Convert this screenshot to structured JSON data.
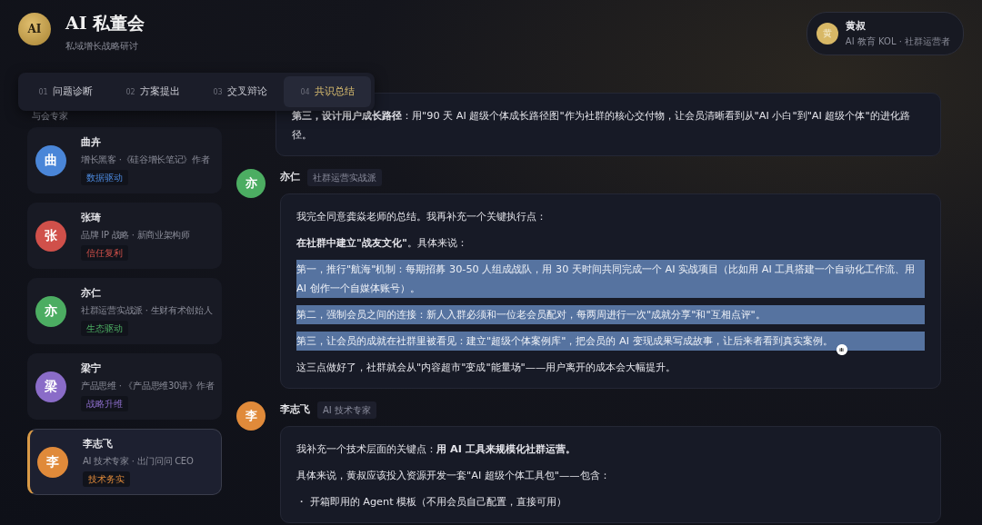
{
  "app": {
    "logo": "AI",
    "title": "AI 私董会",
    "subtitle": "私域增长战略研讨"
  },
  "user": {
    "avatar": "黄",
    "name": "黄叔",
    "role": "AI 教育 KOL · 社群运营者"
  },
  "tabs": [
    {
      "number": "01",
      "label": "问题诊断",
      "selected": false
    },
    {
      "number": "02",
      "label": "方案提出",
      "selected": false
    },
    {
      "number": "03",
      "label": "交叉辩论",
      "selected": false
    },
    {
      "number": "04",
      "label": "共识总结",
      "selected": true
    }
  ],
  "sidebar": {
    "heading": "与会专家",
    "experts": [
      {
        "avatar": "曲",
        "name": "曲卉",
        "title": "增长黑客 ·《硅谷增长笔记》作者",
        "tag": "数据驱动",
        "color": "#4a86d8",
        "selected": false
      },
      {
        "avatar": "张",
        "name": "张琦",
        "title": "品牌 IP 战略 · 新商业架构师",
        "tag": "信任复利",
        "color": "#d0504a",
        "selected": false
      },
      {
        "avatar": "亦",
        "name": "亦仁",
        "title": "社群运营实战派 · 生财有术创始人",
        "tag": "生态驱动",
        "color": "#4cad62",
        "selected": false
      },
      {
        "avatar": "梁",
        "name": "梁宁",
        "title": "产品思维 · 《产品思维30讲》作者",
        "tag": "战略升维",
        "color": "#8a6cc8",
        "selected": false
      },
      {
        "avatar": "李",
        "name": "李志飞",
        "title": "AI 技术专家 · 出门问问 CEO",
        "tag": "技术务实",
        "color": "#e08a3a",
        "selected": true
      }
    ]
  },
  "messages": [
    {
      "paragraphs": [
        {
          "text": "**第三，设计用户成长路径**：用\"90 天 AI 超级个体成长路径图\"作为社群的核心交付物，让会员清晰看到从\"AI 小白\"到\"AI 超级个体\"的进化路径。",
          "highlighted": false
        }
      ]
    },
    {
      "avatar": "亦",
      "name": "亦仁",
      "role": "社群运营实战派",
      "color": "#4cad62",
      "paragraphs": [
        {
          "text": "我完全同意龚焱老师的总结。我再补充一个关键执行点：",
          "highlighted": false
        },
        {
          "text": "**在社群中建立\"战友文化\"**。具体来说：",
          "highlighted": false
        },
        {
          "text": "第一，推行\"航海\"机制：每期招募 30-50 人组成战队，用 30 天时间共同完成一个 AI 实战项目（比如用 AI 工具搭建一个自动化工作流、用 AI 创作一个自媒体账号）。",
          "highlighted": true
        },
        {
          "text": "第二，强制会员之间的连接：新人入群必须和一位老会员配对，每两周进行一次\"成就分享\"和\"互相点评\"。",
          "highlighted": true
        },
        {
          "text": "第三，让会员的成就在社群里被看见：建立\"超级个体案例库\"，把会员的 AI 变现成果写成故事，让后来者看到真实案例。",
          "highlighted": true
        },
        {
          "text": "这三点做好了，社群就会从\"内容超市\"变成\"能量场\"——用户离开的成本会大幅提升。",
          "highlighted": false
        }
      ]
    },
    {
      "avatar": "李",
      "name": "李志飞",
      "role": "AI 技术专家",
      "color": "#e08a3a",
      "paragraphs": [
        {
          "text": "我补充一个技术层面的关键点：**用 AI 工具来规模化社群运营。**",
          "highlighted": false
        },
        {
          "text": "具体来说，黄叔应该投入资源开发一套\"AI 超级个体工具包\"——包含：",
          "highlighted": false
        },
        {
          "text": "・ 开箱即用的 Agent 模板（不用会员自己配置，直接可用）",
          "highlighted": false
        }
      ]
    }
  ]
}
